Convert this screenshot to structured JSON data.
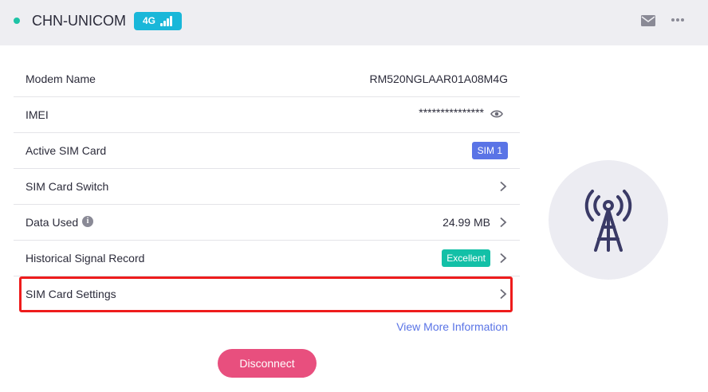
{
  "header": {
    "carrier": "CHN-UNICOM",
    "network_type": "4G",
    "status_color": "#1ec3a6",
    "icons": [
      "mail-icon",
      "more-icon",
      "signal-bars-icon"
    ]
  },
  "rows": {
    "modem_name": {
      "label": "Modem Name",
      "value": "RM520NGLAAR01A08M4G"
    },
    "imei": {
      "label": "IMEI",
      "value": "***************"
    },
    "active_sim": {
      "label": "Active SIM Card",
      "value": "SIM 1"
    },
    "sim_switch": {
      "label": "SIM Card Switch"
    },
    "data_used": {
      "label": "Data Used",
      "value": "24.99 MB"
    },
    "signal_record": {
      "label": "Historical Signal Record",
      "value": "Excellent"
    },
    "sim_settings": {
      "label": "SIM Card Settings"
    }
  },
  "links": {
    "view_more": "View More Information"
  },
  "actions": {
    "disconnect": "Disconnect"
  },
  "colors": {
    "accent": "#5a74e6",
    "success": "#13c0a7",
    "danger": "#e84f7e",
    "highlight": "#ee1c1c"
  }
}
